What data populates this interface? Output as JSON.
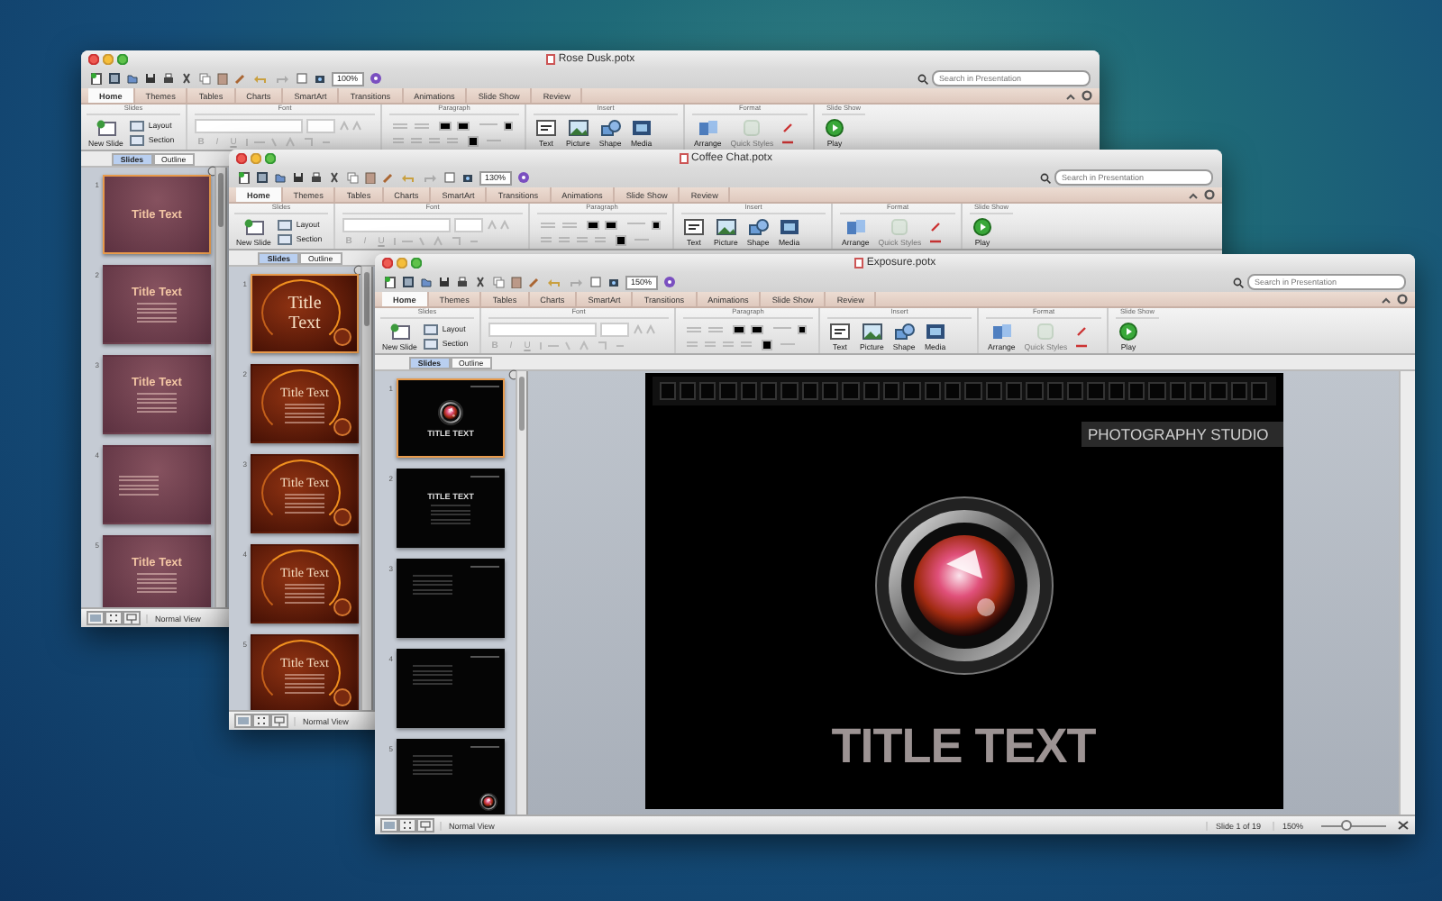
{
  "windows": [
    {
      "title": "Rose Dusk.potx",
      "kind": "rose",
      "toolbar": {
        "zoom": "100%"
      },
      "search": {
        "placeholder": "Search in Presentation"
      },
      "tabs": [
        {
          "label": "Home",
          "selected": true
        },
        {
          "label": "Themes",
          "selected": false
        },
        {
          "label": "Tables",
          "selected": false
        },
        {
          "label": "Charts",
          "selected": false
        },
        {
          "label": "SmartArt",
          "selected": false
        },
        {
          "label": "Transitions",
          "selected": false
        },
        {
          "label": "Animations",
          "selected": false
        },
        {
          "label": "Slide Show",
          "selected": false
        },
        {
          "label": "Review",
          "selected": false
        }
      ],
      "ribbon": {
        "groups": [
          {
            "kind": "slides",
            "label": "Slides",
            "buttons": [
              {
                "label": "New Slide",
                "disabled": false
              },
              {
                "label": "Layout",
                "disabled": false
              },
              {
                "label": "Section",
                "disabled": false
              }
            ]
          },
          {
            "kind": "font",
            "label": "Font",
            "buttons": [
              {
                "label": "B",
                "disabled": true
              },
              {
                "label": "I",
                "disabled": true
              },
              {
                "label": "U",
                "disabled": true
              }
            ]
          },
          {
            "kind": "paragraph",
            "label": "Paragraph"
          },
          {
            "kind": "insert",
            "label": "Insert",
            "buttons": [
              {
                "label": "Text",
                "disabled": false
              },
              {
                "label": "Picture",
                "disabled": false
              },
              {
                "label": "Shape",
                "disabled": false
              },
              {
                "label": "Media",
                "disabled": false
              }
            ]
          },
          {
            "kind": "format",
            "label": "Format",
            "buttons": [
              {
                "label": "Arrange",
                "disabled": false
              },
              {
                "label": "Quick Styles",
                "disabled": true
              }
            ]
          },
          {
            "kind": "slideshow",
            "label": "Slide Show",
            "buttons": [
              {
                "label": "Play",
                "disabled": false
              }
            ]
          }
        ]
      },
      "pane": {
        "tabs": [
          {
            "label": "Slides",
            "selected": true
          },
          {
            "label": "Outline",
            "selected": false
          }
        ],
        "slides": [
          {
            "number": "1",
            "kind": "title",
            "title": "Title Text",
            "selected": true
          },
          {
            "number": "2",
            "kind": "content",
            "title": "Title Text",
            "selected": false
          },
          {
            "number": "3",
            "kind": "content",
            "title": "Title Text",
            "selected": false
          },
          {
            "number": "4",
            "kind": "text",
            "selected": false
          },
          {
            "number": "5",
            "kind": "content",
            "title": "Title Text",
            "selected": false
          }
        ]
      },
      "status": {
        "view": "Normal View"
      }
    },
    {
      "title": "Coffee Chat.potx",
      "kind": "coffee",
      "toolbar": {
        "zoom": "130%"
      },
      "search": {
        "placeholder": "Search in Presentation"
      },
      "tabs": [
        {
          "label": "Home",
          "selected": true
        },
        {
          "label": "Themes",
          "selected": false
        },
        {
          "label": "Tables",
          "selected": false
        },
        {
          "label": "Charts",
          "selected": false
        },
        {
          "label": "SmartArt",
          "selected": false
        },
        {
          "label": "Transitions",
          "selected": false
        },
        {
          "label": "Animations",
          "selected": false
        },
        {
          "label": "Slide Show",
          "selected": false
        },
        {
          "label": "Review",
          "selected": false
        }
      ],
      "ribbon": {
        "groups": [
          {
            "kind": "slides",
            "label": "Slides",
            "buttons": [
              {
                "label": "New Slide",
                "disabled": false
              },
              {
                "label": "Layout",
                "disabled": false
              },
              {
                "label": "Section",
                "disabled": false
              }
            ]
          },
          {
            "kind": "font",
            "label": "Font",
            "buttons": [
              {
                "label": "B",
                "disabled": true
              },
              {
                "label": "I",
                "disabled": true
              },
              {
                "label": "U",
                "disabled": true
              }
            ]
          },
          {
            "kind": "paragraph",
            "label": "Paragraph"
          },
          {
            "kind": "insert",
            "label": "Insert",
            "buttons": [
              {
                "label": "Text",
                "disabled": false
              },
              {
                "label": "Picture",
                "disabled": false
              },
              {
                "label": "Shape",
                "disabled": false
              },
              {
                "label": "Media",
                "disabled": false
              }
            ]
          },
          {
            "kind": "format",
            "label": "Format",
            "buttons": [
              {
                "label": "Arrange",
                "disabled": false
              },
              {
                "label": "Quick Styles",
                "disabled": true
              }
            ]
          },
          {
            "kind": "slideshow",
            "label": "Slide Show",
            "buttons": [
              {
                "label": "Play",
                "disabled": false
              }
            ]
          }
        ]
      },
      "pane": {
        "tabs": [
          {
            "label": "Slides",
            "selected": true
          },
          {
            "label": "Outline",
            "selected": false
          }
        ],
        "slides": [
          {
            "number": "1",
            "kind": "title",
            "title": "Title Text",
            "selected": true
          },
          {
            "number": "2",
            "kind": "content",
            "title": "Title Text",
            "selected": false
          },
          {
            "number": "3",
            "kind": "content",
            "title": "Title Text",
            "selected": false
          },
          {
            "number": "4",
            "kind": "content",
            "title": "Title Text",
            "selected": false
          },
          {
            "number": "5",
            "kind": "content",
            "title": "Title Text",
            "selected": false
          }
        ]
      },
      "status": {
        "view": "Normal View"
      }
    },
    {
      "title": "Exposure.potx",
      "kind": "exposure",
      "toolbar": {
        "zoom": "150%"
      },
      "search": {
        "placeholder": "Search in Presentation"
      },
      "tabs": [
        {
          "label": "Home",
          "selected": true
        },
        {
          "label": "Themes",
          "selected": false
        },
        {
          "label": "Tables",
          "selected": false
        },
        {
          "label": "Charts",
          "selected": false
        },
        {
          "label": "SmartArt",
          "selected": false
        },
        {
          "label": "Transitions",
          "selected": false
        },
        {
          "label": "Animations",
          "selected": false
        },
        {
          "label": "Slide Show",
          "selected": false
        },
        {
          "label": "Review",
          "selected": false
        }
      ],
      "ribbon": {
        "groups": [
          {
            "kind": "slides",
            "label": "Slides",
            "buttons": [
              {
                "label": "New Slide",
                "disabled": false
              },
              {
                "label": "Layout",
                "disabled": false
              },
              {
                "label": "Section",
                "disabled": false
              }
            ]
          },
          {
            "kind": "font",
            "label": "Font",
            "buttons": [
              {
                "label": "B",
                "disabled": true
              },
              {
                "label": "I",
                "disabled": true
              },
              {
                "label": "U",
                "disabled": true
              }
            ]
          },
          {
            "kind": "paragraph",
            "label": "Paragraph"
          },
          {
            "kind": "insert",
            "label": "Insert",
            "buttons": [
              {
                "label": "Text",
                "disabled": false
              },
              {
                "label": "Picture",
                "disabled": false
              },
              {
                "label": "Shape",
                "disabled": false
              },
              {
                "label": "Media",
                "disabled": false
              }
            ]
          },
          {
            "kind": "format",
            "label": "Format",
            "buttons": [
              {
                "label": "Arrange",
                "disabled": false
              },
              {
                "label": "Quick Styles",
                "disabled": true
              }
            ]
          },
          {
            "kind": "slideshow",
            "label": "Slide Show",
            "buttons": [
              {
                "label": "Play",
                "disabled": false
              }
            ]
          }
        ]
      },
      "pane": {
        "tabs": [
          {
            "label": "Slides",
            "selected": true
          },
          {
            "label": "Outline",
            "selected": false
          }
        ],
        "slides": [
          {
            "number": "1",
            "kind": "title",
            "title": "TITLE TEXT",
            "selected": true
          },
          {
            "number": "2",
            "kind": "content",
            "title": "TITLE TEXT",
            "selected": false
          },
          {
            "number": "3",
            "kind": "text",
            "selected": false
          },
          {
            "number": "4",
            "kind": "text",
            "selected": false
          },
          {
            "number": "5",
            "kind": "photo",
            "selected": false
          }
        ]
      },
      "slide": {
        "label": "PHOTOGRAPHY STUDIO",
        "title": "TITLE TEXT"
      },
      "status": {
        "view": "Normal View",
        "position": "Slide 1 of 19",
        "zoom": "150%",
        "zoom_slider": {
          "level": 0.4
        }
      }
    }
  ]
}
